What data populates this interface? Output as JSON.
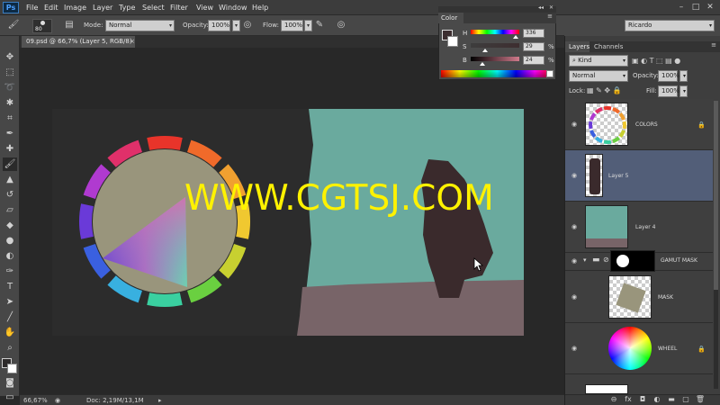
{
  "app": {
    "logo": "Ps"
  },
  "menu": {
    "items": [
      "File",
      "Edit",
      "Image",
      "Layer",
      "Type",
      "Select",
      "Filter",
      "View",
      "Window",
      "Help"
    ]
  },
  "window_controls": [
    "–",
    "□",
    "✕"
  ],
  "options": {
    "brush_size": "80",
    "mode_label": "Mode:",
    "mode_value": "Normal",
    "opacity_label": "Opacity:",
    "opacity_value": "100%",
    "flow_label": "Flow:",
    "flow_value": "100%"
  },
  "workspace": {
    "name": "Ricardo"
  },
  "document": {
    "tab_title": "09.psd @ 66,7% (Layer 5, RGB/8) *",
    "close": "×"
  },
  "status": {
    "zoom": "66,67%",
    "doc": "Doc: 2,19M/13,1M"
  },
  "color_panel": {
    "title": "Color",
    "sliders": [
      {
        "label": "H",
        "value": "336",
        "unit": "",
        "fraction": 0.93
      },
      {
        "label": "S",
        "value": "29",
        "unit": "%",
        "fraction": 0.29
      },
      {
        "label": "B",
        "value": "24",
        "unit": "%",
        "fraction": 0.24
      }
    ],
    "foreground": "#3d2e30",
    "background": "#ffffff"
  },
  "layers_panel": {
    "tabs": [
      "Layers",
      "Channels"
    ],
    "filter_label": "Kind",
    "blend_mode": "Normal",
    "opacity_label": "Opacity:",
    "opacity_value": "100%",
    "lock_label": "Lock:",
    "fill_label": "Fill:",
    "fill_value": "100%",
    "layers": [
      {
        "name": "COLORS",
        "locked": true,
        "selected": false,
        "thumb": "colors-ring"
      },
      {
        "name": "Layer 5",
        "locked": false,
        "selected": true,
        "thumb": "dark-stroke"
      },
      {
        "name": "Layer 4",
        "locked": false,
        "selected": false,
        "thumb": "teal-mauve"
      },
      {
        "name": "GAMUT MASK",
        "locked": false,
        "selected": false,
        "thumb": "mask-circle",
        "group": true
      },
      {
        "name": "MASK",
        "locked": false,
        "selected": false,
        "thumb": "gray-diamond"
      },
      {
        "name": "WHEEL",
        "locked": true,
        "selected": false,
        "thumb": "color-wheel"
      }
    ]
  },
  "canvas": {
    "teal": "#6aaa9e",
    "mauve": "#786468",
    "dark": "#3a2a2c",
    "wheel_inner": "#99957c"
  },
  "watermark": "WWW.CGTSJ.COM"
}
